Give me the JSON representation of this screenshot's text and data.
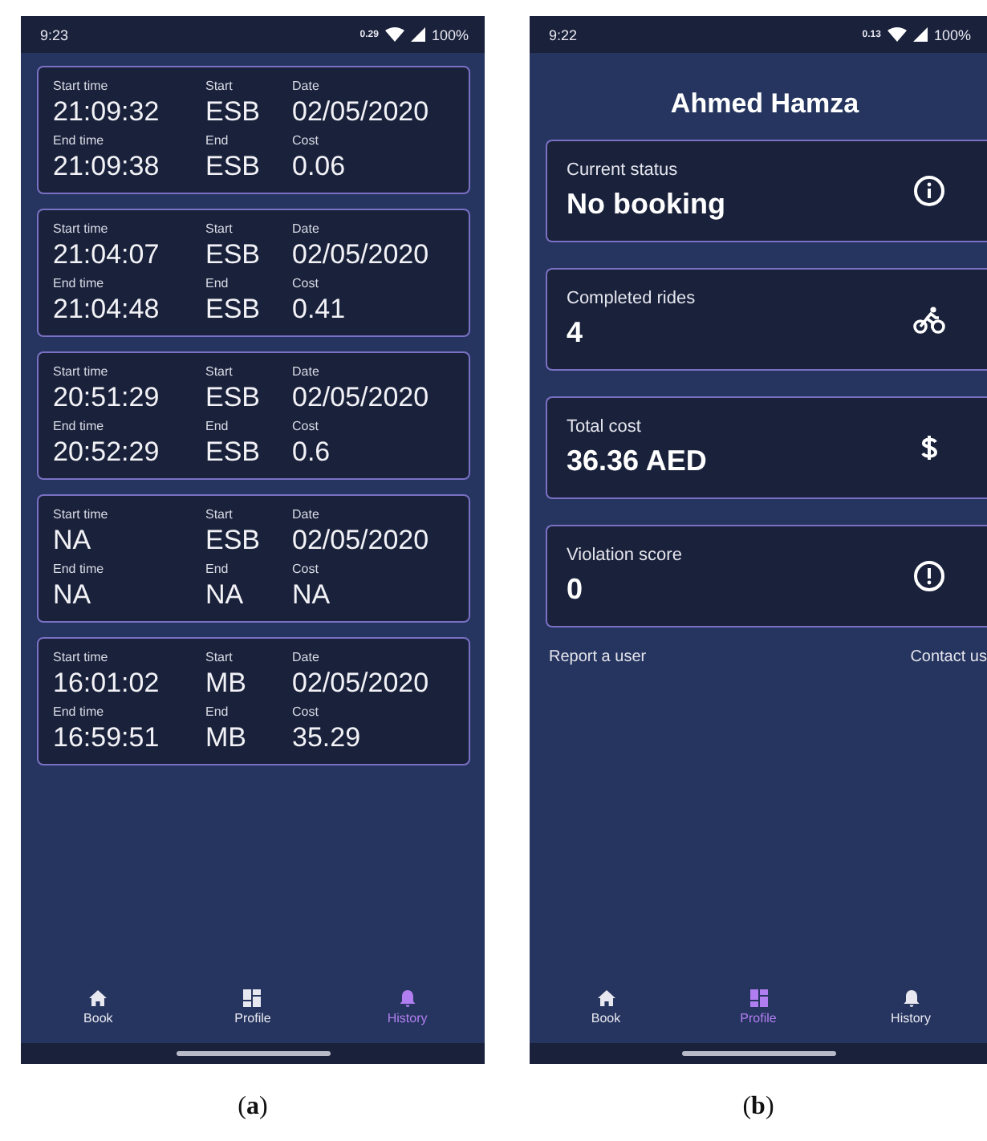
{
  "panels": [
    {
      "caption": "(**a**)",
      "kind": "history",
      "status_bar": {
        "time": "9:23",
        "data_rate": "0.29",
        "battery": "100%"
      },
      "rides": [
        {
          "fields": [
            {
              "label": "Start time",
              "value": "21:09:32"
            },
            {
              "label": "Start",
              "value": "ESB"
            },
            {
              "label": "Date",
              "value": "02/05/2020"
            },
            {
              "label": "End time",
              "value": "21:09:38"
            },
            {
              "label": "End",
              "value": "ESB"
            },
            {
              "label": "Cost",
              "value": "0.06"
            }
          ]
        },
        {
          "fields": [
            {
              "label": "Start time",
              "value": "21:04:07"
            },
            {
              "label": "Start",
              "value": "ESB"
            },
            {
              "label": "Date",
              "value": "02/05/2020"
            },
            {
              "label": "End time",
              "value": "21:04:48"
            },
            {
              "label": "End",
              "value": "ESB"
            },
            {
              "label": "Cost",
              "value": "0.41"
            }
          ]
        },
        {
          "fields": [
            {
              "label": "Start time",
              "value": "20:51:29"
            },
            {
              "label": "Start",
              "value": "ESB"
            },
            {
              "label": "Date",
              "value": "02/05/2020"
            },
            {
              "label": "End time",
              "value": "20:52:29"
            },
            {
              "label": "End",
              "value": "ESB"
            },
            {
              "label": "Cost",
              "value": "0.6"
            }
          ]
        },
        {
          "fields": [
            {
              "label": "Start time",
              "value": "NA"
            },
            {
              "label": "Start",
              "value": "ESB"
            },
            {
              "label": "Date",
              "value": "02/05/2020"
            },
            {
              "label": "End time",
              "value": "NA"
            },
            {
              "label": "End",
              "value": "NA"
            },
            {
              "label": "Cost",
              "value": "NA"
            }
          ]
        },
        {
          "fields": [
            {
              "label": "Start time",
              "value": "16:01:02"
            },
            {
              "label": "Start",
              "value": "MB"
            },
            {
              "label": "Date",
              "value": "02/05/2020"
            },
            {
              "label": "End time",
              "value": "16:59:51"
            },
            {
              "label": "End",
              "value": "MB"
            },
            {
              "label": "Cost",
              "value": "35.29"
            }
          ]
        }
      ],
      "nav": [
        {
          "label": "Book",
          "kind": "home",
          "selected": false
        },
        {
          "label": "Profile",
          "kind": "grid",
          "selected": false
        },
        {
          "label": "History",
          "kind": "bell",
          "selected": true
        }
      ]
    },
    {
      "caption": "(**b**)",
      "kind": "profile",
      "status_bar": {
        "time": "9:22",
        "data_rate": "0.13",
        "battery": "100%"
      },
      "title": "Ahmed Hamza",
      "stats": [
        {
          "label": "Current status",
          "value": "No booking",
          "kind": "info"
        },
        {
          "label": "Completed rides",
          "value": "4",
          "kind": "bike"
        },
        {
          "label": "Total cost",
          "value": "36.36 AED",
          "kind": "dollar"
        },
        {
          "label": "Violation score",
          "value": "0",
          "kind": "alert"
        }
      ],
      "links": [
        "Report a user",
        "Contact us"
      ],
      "nav": [
        {
          "label": "Book",
          "kind": "home",
          "selected": false
        },
        {
          "label": "Profile",
          "kind": "grid",
          "selected": true
        },
        {
          "label": "History",
          "kind": "bell",
          "selected": false
        }
      ]
    }
  ]
}
